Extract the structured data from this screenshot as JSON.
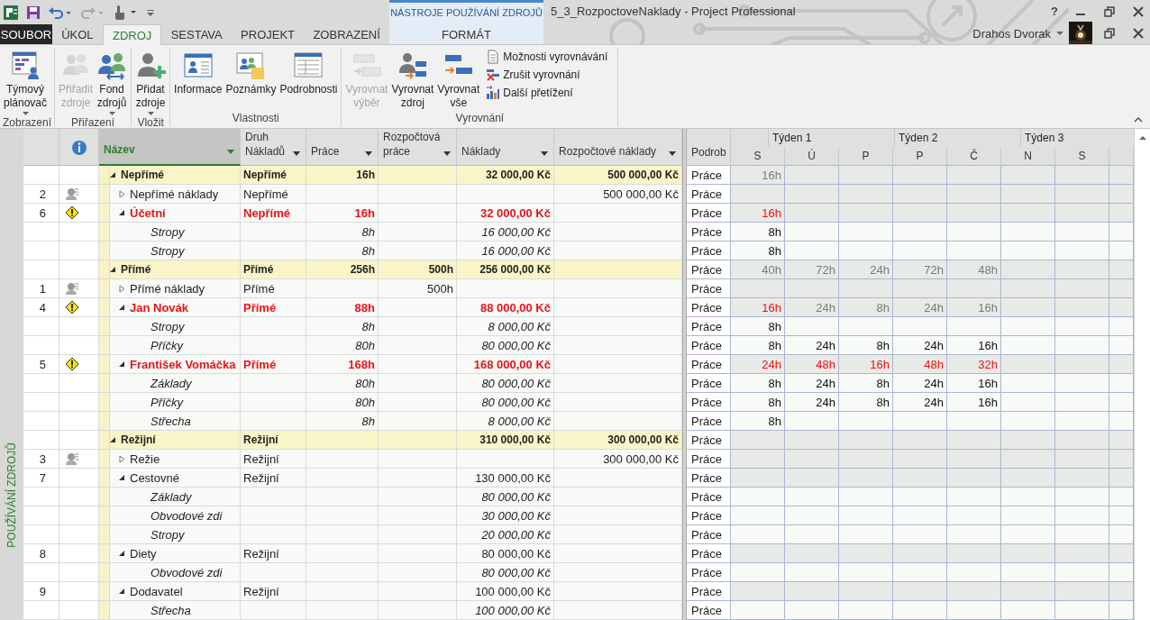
{
  "title_bar": {
    "context_group": "NÁSTROJE POUŽÍVÁNÍ ZDROJŮ",
    "title": "5_3_RozpoctoveNaklady - Project Professional",
    "help": "?",
    "user": "Drahos Dvorak"
  },
  "tabs": [
    {
      "label": "SOUBOR",
      "kind": "file",
      "selected": false
    },
    {
      "label": "ÚKOL",
      "kind": "tab",
      "selected": false
    },
    {
      "label": "ZDROJ",
      "kind": "tab",
      "selected": true
    },
    {
      "label": "SESTAVA",
      "kind": "tab",
      "selected": false
    },
    {
      "label": "PROJEKT",
      "kind": "tab",
      "selected": false
    },
    {
      "label": "ZOBRAZENÍ",
      "kind": "tab",
      "selected": false
    },
    {
      "label": "FORMÁT",
      "kind": "context",
      "selected": false
    }
  ],
  "ribbon": [
    {
      "label": "Zobrazení",
      "buttons": [
        {
          "lines": [
            "Týmový",
            "plánovač"
          ],
          "dropdown": true,
          "disabled": false
        }
      ]
    },
    {
      "label": "Přiřazení",
      "buttons": [
        {
          "lines": [
            "Přiřadit",
            "zdroje"
          ],
          "dropdown": false,
          "disabled": true
        },
        {
          "lines": [
            "Fond",
            "zdrojů"
          ],
          "dropdown": true,
          "disabled": false
        }
      ]
    },
    {
      "label": "Vložit",
      "buttons": [
        {
          "lines": [
            "Přidat",
            "zdroje"
          ],
          "dropdown": true,
          "disabled": false
        }
      ]
    },
    {
      "label": "Vlastnosti",
      "buttons": [
        {
          "lines": [
            "Informace"
          ],
          "dropdown": false,
          "disabled": false
        },
        {
          "lines": [
            "Poznámky"
          ],
          "dropdown": false,
          "disabled": false
        },
        {
          "lines": [
            "Podrobnosti"
          ],
          "dropdown": false,
          "disabled": false
        }
      ]
    },
    {
      "label": "Vyrovnání",
      "buttons": [
        {
          "lines": [
            "Vyrovnat",
            "výběr"
          ],
          "dropdown": false,
          "disabled": true
        },
        {
          "lines": [
            "Vyrovnat",
            "zdroj"
          ],
          "dropdown": false,
          "disabled": false
        },
        {
          "lines": [
            "Vyrovnat",
            "vše"
          ],
          "dropdown": false,
          "disabled": false
        }
      ],
      "small_buttons": [
        {
          "label": "Možnosti vyrovnávání"
        },
        {
          "label": "Zrušit vyrovnání"
        },
        {
          "label": "Další přetížení"
        }
      ]
    }
  ],
  "view_bar": {
    "label": "POUŽÍVÁNÍ ZDROJŮ"
  },
  "columns": [
    {
      "lines": [
        "Název"
      ],
      "selected": true
    },
    {
      "lines": [
        "Druh",
        "Nákladů"
      ],
      "selected": false
    },
    {
      "lines": [
        "Práce"
      ],
      "selected": false
    },
    {
      "lines": [
        "Rozpočtová",
        "práce"
      ],
      "selected": false
    },
    {
      "lines": [
        "Náklady"
      ],
      "selected": false
    },
    {
      "lines": [
        "Rozpočtové náklady"
      ],
      "selected": false
    }
  ],
  "timescale": {
    "detail_header": "Podrob",
    "weeks": [
      "Týden 1",
      "Týden 2",
      "Týden 3"
    ],
    "days": [
      "S",
      "Ú",
      "P",
      "P",
      "Č",
      "N",
      "S"
    ]
  },
  "rows": [
    {
      "kind": "group",
      "name": "Nepřímé",
      "expanded": true,
      "type": "Nepřímé",
      "work": "16h",
      "cost": "32 000,00 Kč",
      "budget_cost": "500 000,00 Kč",
      "detail": "Práce",
      "days": [
        {
          "value": "16h",
          "overallocated": false
        }
      ],
      "children": [
        {
          "kind": "resource",
          "id": "2",
          "budget": true,
          "name": "Nepřímé náklady",
          "expanded": false,
          "overallocated": false,
          "type": "Nepřímé",
          "budget_cost": "500 000,00 Kč",
          "detail": "Práce"
        },
        {
          "kind": "resource",
          "id": "6",
          "budget": false,
          "name": "Účetní",
          "expanded": true,
          "overallocated": true,
          "type": "Nepřímé",
          "work": "16h",
          "cost": "32 000,00 Kč",
          "detail": "Práce",
          "days": [
            {
              "value": "16h",
              "overallocated": true
            }
          ],
          "children": [
            {
              "kind": "assignment",
              "name": "Stropy",
              "work": "8h",
              "cost": "16 000,00 Kč",
              "detail": "Práce",
              "days": [
                {
                  "value": "8h",
                  "overallocated": false
                }
              ]
            },
            {
              "kind": "assignment",
              "name": "Stropy",
              "work": "8h",
              "cost": "16 000,00 Kč",
              "detail": "Práce",
              "days": [
                {
                  "value": "8h",
                  "overallocated": false
                }
              ]
            }
          ]
        }
      ]
    },
    {
      "kind": "group",
      "name": "Přímé",
      "expanded": true,
      "type": "Přímé",
      "work": "256h",
      "budget_work": "500h",
      "cost": "256 000,00 Kč",
      "detail": "Práce",
      "days": [
        {
          "value": "40h",
          "overallocated": false
        },
        {
          "value": "72h",
          "overallocated": false
        },
        {
          "value": "24h",
          "overallocated": false
        },
        {
          "value": "72h",
          "overallocated": false
        },
        {
          "value": "48h",
          "overallocated": false
        }
      ],
      "children": [
        {
          "kind": "resource",
          "id": "1",
          "budget": true,
          "name": "Přímé náklady",
          "expanded": false,
          "overallocated": false,
          "type": "Přímé",
          "budget_work": "500h",
          "detail": "Práce"
        },
        {
          "kind": "resource",
          "id": "4",
          "budget": false,
          "name": "Jan Novák",
          "expanded": true,
          "overallocated": true,
          "type": "Přímé",
          "work": "88h",
          "cost": "88 000,00 Kč",
          "detail": "Práce",
          "days": [
            {
              "value": "16h",
              "overallocated": true
            },
            {
              "value": "24h",
              "overallocated": false
            },
            {
              "value": "8h",
              "overallocated": false
            },
            {
              "value": "24h",
              "overallocated": false
            },
            {
              "value": "16h",
              "overallocated": false
            }
          ],
          "children": [
            {
              "kind": "assignment",
              "name": "Stropy",
              "work": "8h",
              "cost": "8 000,00 Kč",
              "detail": "Práce",
              "days": [
                {
                  "value": "8h",
                  "overallocated": false
                }
              ]
            },
            {
              "kind": "assignment",
              "name": "Příčky",
              "work": "80h",
              "cost": "80 000,00 Kč",
              "detail": "Práce",
              "days": [
                {
                  "value": "8h",
                  "overallocated": false
                },
                {
                  "value": "24h",
                  "overallocated": false
                },
                {
                  "value": "8h",
                  "overallocated": false
                },
                {
                  "value": "24h",
                  "overallocated": false
                },
                {
                  "value": "16h",
                  "overallocated": false
                }
              ]
            }
          ]
        },
        {
          "kind": "resource",
          "id": "5",
          "budget": false,
          "name": "František Vomáčka",
          "expanded": true,
          "overallocated": true,
          "type": "Přímé",
          "work": "168h",
          "cost": "168 000,00 Kč",
          "detail": "Práce",
          "days": [
            {
              "value": "24h",
              "overallocated": true
            },
            {
              "value": "48h",
              "overallocated": true
            },
            {
              "value": "16h",
              "overallocated": true
            },
            {
              "value": "48h",
              "overallocated": true
            },
            {
              "value": "32h",
              "overallocated": true
            }
          ],
          "children": [
            {
              "kind": "assignment",
              "name": "Základy",
              "work": "80h",
              "cost": "80 000,00 Kč",
              "detail": "Práce",
              "days": [
                {
                  "value": "8h",
                  "overallocated": false
                },
                {
                  "value": "24h",
                  "overallocated": false
                },
                {
                  "value": "8h",
                  "overallocated": false
                },
                {
                  "value": "24h",
                  "overallocated": false
                },
                {
                  "value": "16h",
                  "overallocated": false
                }
              ]
            },
            {
              "kind": "assignment",
              "name": "Příčky",
              "work": "80h",
              "cost": "80 000,00 Kč",
              "detail": "Práce",
              "days": [
                {
                  "value": "8h",
                  "overallocated": false
                },
                {
                  "value": "24h",
                  "overallocated": false
                },
                {
                  "value": "8h",
                  "overallocated": false
                },
                {
                  "value": "24h",
                  "overallocated": false
                },
                {
                  "value": "16h",
                  "overallocated": false
                }
              ]
            },
            {
              "kind": "assignment",
              "name": "Střecha",
              "work": "8h",
              "cost": "8 000,00 Kč",
              "detail": "Práce",
              "days": [
                {
                  "value": "8h",
                  "overallocated": false
                }
              ]
            }
          ]
        }
      ]
    },
    {
      "kind": "group",
      "name": "Režijní",
      "expanded": true,
      "type": "Režijní",
      "cost": "310 000,00 Kč",
      "budget_cost": "300 000,00 Kč",
      "detail": "Práce",
      "children": [
        {
          "kind": "resource",
          "id": "3",
          "budget": true,
          "name": "Režie",
          "expanded": false,
          "overallocated": false,
          "type": "Režijní",
          "budget_cost": "300 000,00 Kč",
          "detail": "Práce"
        },
        {
          "kind": "resource",
          "id": "7",
          "budget": false,
          "name": "Cestovné",
          "expanded": true,
          "overallocated": false,
          "type": "Režijní",
          "cost": "130 000,00 Kč",
          "detail": "Práce",
          "children": [
            {
              "kind": "assignment",
              "name": "Základy",
              "cost": "80 000,00 Kč",
              "detail": "Práce"
            },
            {
              "kind": "assignment",
              "name": "Obvodové zdi",
              "cost": "30 000,00 Kč",
              "detail": "Práce"
            },
            {
              "kind": "assignment",
              "name": "Stropy",
              "cost": "20 000,00 Kč",
              "detail": "Práce"
            }
          ]
        },
        {
          "kind": "resource",
          "id": "8",
          "budget": false,
          "name": "Diety",
          "expanded": true,
          "overallocated": false,
          "type": "Režijní",
          "cost": "80 000,00 Kč",
          "detail": "Práce",
          "children": [
            {
              "kind": "assignment",
              "name": "Obvodové zdi",
              "cost": "80 000,00 Kč",
              "detail": "Práce"
            }
          ]
        },
        {
          "kind": "resource",
          "id": "9",
          "budget": false,
          "name": "Dodavatel",
          "expanded": true,
          "overallocated": false,
          "type": "Režijní",
          "cost": "100 000,00 Kč",
          "detail": "Práce",
          "children": [
            {
              "kind": "assignment",
              "name": "Střecha",
              "cost": "100 000,00 Kč",
              "detail": "Práce"
            }
          ]
        }
      ]
    }
  ]
}
